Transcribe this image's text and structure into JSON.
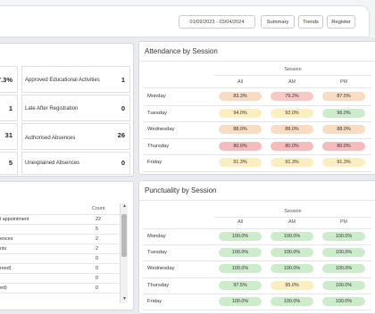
{
  "toolbar": {
    "date_range": "01/09/2023 - 03/04/2024",
    "buttons": [
      "Summary",
      "Trends",
      "Register"
    ]
  },
  "left_stats": {
    "items": [
      {
        "label": "Approved Educational Activities",
        "value": "1",
        "left_value": "7.3%"
      },
      {
        "label": "Late After Registration",
        "value": "0",
        "left_value": "1"
      },
      {
        "label": "Authorised Absences",
        "value": "26",
        "left_value": "31"
      },
      {
        "label": "Unexplained Absences",
        "value": "0",
        "left_value": "5"
      }
    ]
  },
  "left_table": {
    "header": "Count",
    "rows": [
      {
        "label": "l appointment",
        "count": "22"
      },
      {
        "label": "",
        "count": "5"
      },
      {
        "label": "ences",
        "count": "2"
      },
      {
        "label": "nts",
        "count": "2"
      },
      {
        "label": "",
        "count": "0"
      },
      {
        "label": "reed)",
        "count": "0"
      },
      {
        "label": "",
        "count": "0"
      },
      {
        "label": "ed)",
        "count": "0"
      }
    ]
  },
  "attendance": {
    "title": "Attendance by Session",
    "group_header": "Session",
    "columns": [
      "All",
      "AM",
      "PM"
    ],
    "rows": [
      {
        "day": "Monday",
        "values": [
          "83.3%",
          "79.2%",
          "87.5%"
        ],
        "colors": [
          "#f8dcc4",
          "#f6c9c6",
          "#f8dcc4"
        ]
      },
      {
        "day": "Tuesday",
        "values": [
          "94.0%",
          "92.0%",
          "96.0%"
        ],
        "colors": [
          "#fbefc1",
          "#fbefc1",
          "#cdeccb"
        ]
      },
      {
        "day": "Wednesday",
        "values": [
          "88.0%",
          "88.0%",
          "88.0%"
        ],
        "colors": [
          "#f8dcc4",
          "#f8dcc4",
          "#f8dcc4"
        ]
      },
      {
        "day": "Thursday",
        "values": [
          "80.0%",
          "80.0%",
          "80.0%"
        ],
        "colors": [
          "#f4bcbc",
          "#f4bcbc",
          "#f4bcbc"
        ]
      },
      {
        "day": "Friday",
        "values": [
          "91.3%",
          "91.3%",
          "91.3%"
        ],
        "colors": [
          "#fbefc1",
          "#fbefc1",
          "#fbefc1"
        ]
      }
    ]
  },
  "punctuality": {
    "title": "Punctuality by Session",
    "group_header": "Session",
    "columns": [
      "All",
      "AM",
      "PM"
    ],
    "rows": [
      {
        "day": "Monday",
        "values": [
          "100.0%",
          "100.0%",
          "100.0%"
        ],
        "colors": [
          "#cdeccb",
          "#cdeccb",
          "#cdeccb"
        ]
      },
      {
        "day": "Tuesday",
        "values": [
          "100.0%",
          "100.0%",
          "100.0%"
        ],
        "colors": [
          "#cdeccb",
          "#cdeccb",
          "#cdeccb"
        ]
      },
      {
        "day": "Wednesday",
        "values": [
          "100.0%",
          "100.0%",
          "100.0%"
        ],
        "colors": [
          "#cdeccb",
          "#cdeccb",
          "#cdeccb"
        ]
      },
      {
        "day": "Thursday",
        "values": [
          "97.5%",
          "95.0%",
          "100.0%"
        ],
        "colors": [
          "#cdeccb",
          "#fbefc1",
          "#cdeccb"
        ]
      },
      {
        "day": "Friday",
        "values": [
          "100.0%",
          "100.0%",
          "100.0%"
        ],
        "colors": [
          "#cdeccb",
          "#cdeccb",
          "#cdeccb"
        ]
      }
    ]
  }
}
